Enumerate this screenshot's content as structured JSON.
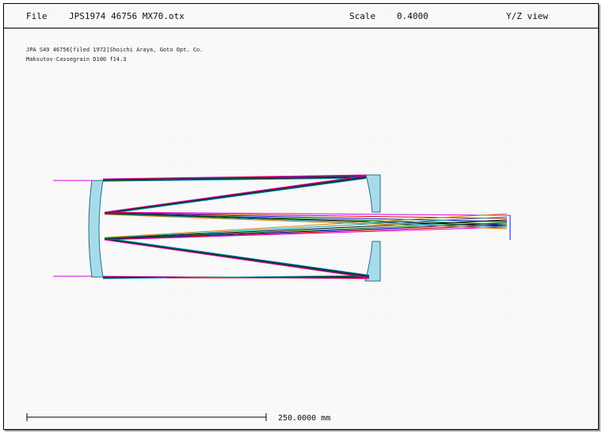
{
  "header": {
    "file_label": "File",
    "file_name": "JPS1974 46756 MX70.otx",
    "scale_label": "Scale",
    "scale_value": "0.4000",
    "view": "Y/Z view"
  },
  "description": {
    "line1": "JPA S49 46756[filed 1972]Shoichi Araya, Goto Opt. Co.",
    "line2": "Maksutov-Cassegrain D100 f14.3"
  },
  "scale_bar": {
    "label": "250.0000 mm"
  },
  "colors": {
    "lens_fill": "#a6dcea",
    "lens_edge": "#2a6e84",
    "ray_magenta": "#e000e0",
    "ray_red": "#d40000",
    "ray_blue": "#1010d0",
    "ray_green": "#008000",
    "ray_cyan": "#00a0c0",
    "ray_black": "#000000",
    "ray_orange": "#e08000"
  }
}
